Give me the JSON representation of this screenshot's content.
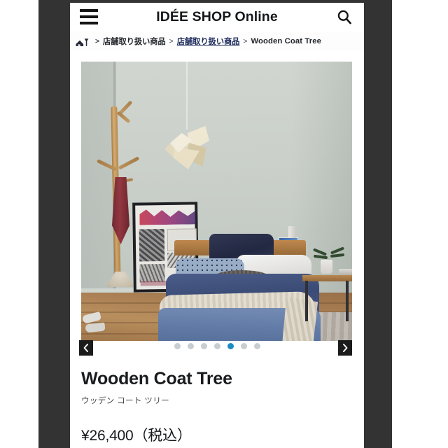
{
  "window": {
    "band_color": "#333333",
    "page_bg": "#ffffff"
  },
  "header": {
    "brand": "IDÉE SHOP Online",
    "menu_icon": "hamburger-menu-icon",
    "search_icon": "search-icon"
  },
  "breadcrumb": {
    "home_icon": "home-icon",
    "separator": ">",
    "items": [
      {
        "label": "店舗取り扱い商品",
        "is_link": false
      },
      {
        "label": "店舗取り扱い商品",
        "is_link": true
      },
      {
        "label": "Wooden Coat Tree",
        "is_link": false
      }
    ]
  },
  "gallery": {
    "prev_label": "‹",
    "next_label": "›",
    "prev_icon": "chevron-left-icon",
    "next_icon": "chevron-right-icon",
    "dot_count": 7,
    "active_dot_index": 5,
    "active_dot_color": "#1d8cc4",
    "inactive_dot_color": "#c8cdd1",
    "image_alt": "Bedroom interior with wooden coat tree, geometric paper pendant lamp, framed poster and blue linen bed"
  },
  "product": {
    "title": "Wooden Coat Tree",
    "subtitle": "ウッデン コート ツリー",
    "price": "¥26,400（税込）"
  }
}
